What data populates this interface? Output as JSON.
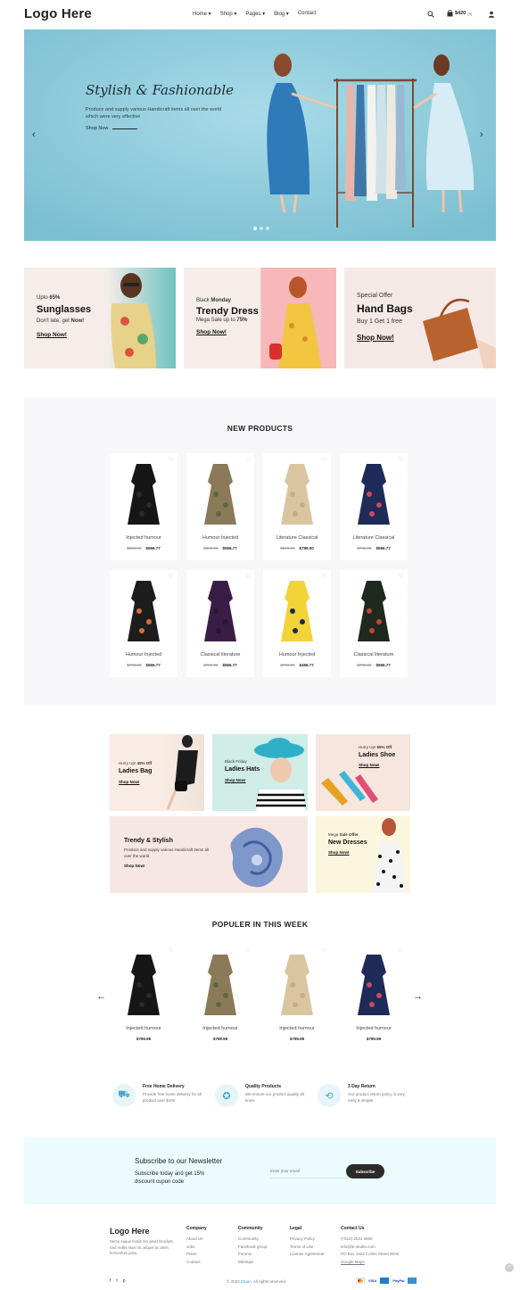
{
  "header": {
    "logo": "Logo Here",
    "nav": [
      "Home",
      "Shop",
      "Pages",
      "Blog",
      "Contact"
    ],
    "cart_total": "$420",
    "cart_count": "(9)"
  },
  "hero": {
    "title": "Stylish & Fashionable",
    "subtitle": "Produce and supply various Handicraft items all over the world which were very effective",
    "link": "Shop Now"
  },
  "promos": [
    {
      "pre": "Upto",
      "pre_bold": "65%",
      "title": "Sunglasses",
      "desc": "Don't late, get",
      "desc_bold": "Now!",
      "link": "Shop Now!"
    },
    {
      "pre": "Black",
      "pre_bold": "Monday",
      "title": "Trendy Dress",
      "desc": "Mega Sale up to",
      "desc_bold": "75%",
      "link": "Shop Now!"
    },
    {
      "pre": "Special Offer",
      "title": "Hand Bags",
      "desc": "Buy 1 Get 1 free",
      "link": "Shop Now!"
    }
  ],
  "new_products": {
    "title": "NEW PRODUCTS",
    "items": [
      {
        "name": "Injected humour",
        "old": "$599.00",
        "price": "$566.77"
      },
      {
        "name": "Humour Injected",
        "old": "$599.00",
        "price": "$566.77"
      },
      {
        "name": "Literature Classical",
        "old": "$599.00",
        "price": "$799.00"
      },
      {
        "name": "Literature Classical",
        "old": "$799.00",
        "price": "$566.77"
      },
      {
        "name": "Humour Injected",
        "old": "$799.00",
        "price": "$566.77"
      },
      {
        "name": "Classical literature",
        "old": "$799.00",
        "price": "$566.77"
      },
      {
        "name": "Humour Injected",
        "old": "$799.00",
        "price": "$466.77"
      },
      {
        "name": "Classical literature",
        "old": "$799.00",
        "price": "$566.77"
      }
    ]
  },
  "tiles": [
    {
      "small": "Hurry Up!",
      "small_bold": "45% Off",
      "title": "Ladies Bag",
      "link": "Shop Now!"
    },
    {
      "small": "Black Friday",
      "title": "Ladies Hats",
      "link": "Shop Now!"
    },
    {
      "small": "Hurry Up!",
      "small_bold": "65% Off",
      "title": "Ladies Shoe",
      "link": "Shop Now!"
    },
    {
      "title": "Trendy & Stylish",
      "desc": "Produce and supply various Handicraft items all over the world",
      "link": "Shop Now!"
    },
    {
      "small": "Mega",
      "small_bold": "Sale Offer",
      "title": "New Dresses",
      "link": "Shop Now!"
    }
  ],
  "popular": {
    "title": "POPULER IN THIS WEEK",
    "items": [
      {
        "name": "Injected humour",
        "price": "$799.99"
      },
      {
        "name": "Injected humour",
        "price": "$799.99"
      },
      {
        "name": "Injected humour",
        "price": "$799.99"
      },
      {
        "name": "Injected humour",
        "price": "$799.99"
      }
    ]
  },
  "features": [
    {
      "title": "Free Home Delivery",
      "desc": "Provide free home delivery for all product over $100"
    },
    {
      "title": "Quality Products",
      "desc": "We ensure our product quality all times"
    },
    {
      "title": "3 Day Return",
      "desc": "Our product return policy is very easy & simple"
    }
  ],
  "newsletter": {
    "title": "Subscribe to our Newsletter",
    "desc": "Subscribe today and get 15% discount cupon code",
    "placeholder": "Enter your email",
    "button": "Subscribe"
  },
  "footer": {
    "logo": "Logo Here",
    "about": "Nemo eaque mollis nisi proid tincidunt. Sed mollis risus mi, aliquet ac amet fermentum justo.",
    "company": {
      "title": "Company",
      "links": [
        "About Us",
        "Jobs",
        "Press",
        "Contact"
      ]
    },
    "community": {
      "title": "Community",
      "links": [
        "Community",
        "Facebook group",
        "Forums",
        "Meetups"
      ]
    },
    "legal": {
      "title": "Legal",
      "links": [
        "Privacy Policy",
        "Terms of Use",
        "License Agreement"
      ]
    },
    "contact": {
      "title": "Contact Us",
      "lines": [
        "(+612) 2531 5600",
        "info@le-studio.com",
        "PO Box 1622 Colins Street West",
        "Google Maps"
      ]
    },
    "copyright_pre": "© 2023",
    "copyright_brand": "Etrain",
    "copyright_post": ". All rights reserved.",
    "payments": [
      "VISA",
      "PayPal"
    ]
  },
  "colors": {
    "accent": "#4aa6c7",
    "hero_bg": "#8fcbdc",
    "newsletter_bg": "#ecfbfd",
    "section_bg": "#f7f6f9"
  }
}
